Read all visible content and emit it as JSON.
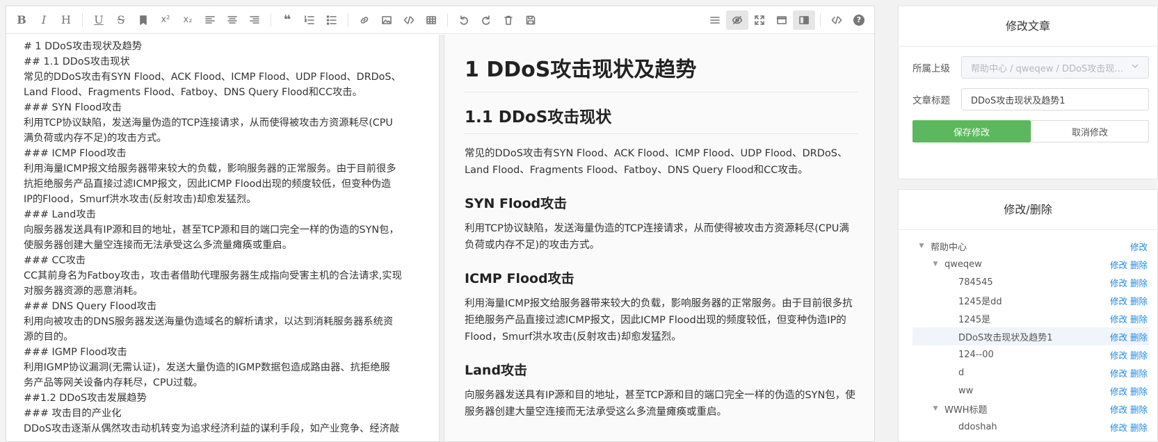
{
  "toolbar": {
    "left": [
      "bold-icon",
      "italic-icon",
      "heading-icon",
      "underline-icon",
      "strikethrough-icon",
      "bookmark-icon",
      "superscript-icon",
      "subscript-icon",
      "align-left-icon",
      "align-center-icon",
      "align-right-icon",
      "quote-icon",
      "ordered-list-icon",
      "unordered-list-icon",
      "link-icon",
      "image-icon",
      "code-icon",
      "table-icon",
      "undo-icon",
      "redo-icon",
      "trash-icon",
      "save-icon"
    ],
    "right": [
      "navigation-icon",
      "preview-toggle-icon",
      "fullscreen-icon",
      "window-icon",
      "split-view-icon",
      "html-code-icon",
      "help-icon"
    ],
    "glyphs": {
      "bold": "B",
      "italic": "I",
      "heading": "H",
      "underline": "U",
      "strike": "S",
      "sup": "x²",
      "sub": "x₂",
      "quote": "❝",
      "help": "?"
    }
  },
  "source": {
    "lines": [
      "# 1 DDoS攻击现状及趋势",
      "## 1.1 DDoS攻击现状",
      "常见的DDoS攻击有SYN Flood、ACK Flood、ICMP Flood、UDP Flood、DRDoS、",
      "Land Flood、Fragments Flood、Fatboy、DNS Query Flood和CC攻击。",
      "### SYN Flood攻击",
      "利用TCP协议缺陷，发送海量伪造的TCP连接请求，从而使得被攻击方资源耗尽(CPU",
      "满负荷或内存不足)的攻击方式。",
      "### ICMP Flood攻击",
      "利用海量ICMP报文给服务器带来较大的负载，影响服务器的正常服务。由于目前很多",
      "抗拒绝服务产品直接过滤ICMP报文，因此ICMP Flood出现的频度较低，但变种伪造",
      "IP的Flood，Smurf洪水攻击(反射攻击)却愈发猛烈。",
      "### Land攻击",
      "向服务器发送具有IP源和目的地址，甚至TCP源和目的端口完全一样的伪造的SYN包，",
      "使服务器创建大量空连接而无法承受这么多流量瘫痪或重启。",
      "### CC攻击",
      "CC其前身名为Fatboy攻击，攻击者借助代理服务器生成指向受害主机的合法请求,实现",
      "对服务器资源的恶意消耗。",
      "### DNS Query Flood攻击",
      "利用向被攻击的DNS服务器发送海量伪造域名的解析请求，以达到消耗服务器系统资",
      "源的目的。",
      "### IGMP Flood攻击",
      "利用IGMP协议漏洞(无需认证)，发送大量伪造的IGMP数据包造成路由器、抗拒绝服",
      "务产品等网关设备内存耗尽，CPU过载。",
      "##1.2 DDoS攻击发展趋势",
      "### 攻击目的产业化",
      "DDoS攻击逐渐从偶然攻击动机转变为追求经济利益的谋利手段，如产业竞争、经济敲"
    ]
  },
  "preview": {
    "h1": "1 DDoS攻击现状及趋势",
    "h2": "1.1 DDoS攻击现状",
    "p1": "常见的DDoS攻击有SYN Flood、ACK Flood、ICMP Flood、UDP Flood、DRDoS、Land Flood、Fragments Flood、Fatboy、DNS Query Flood和CC攻击。",
    "h3a": "SYN Flood攻击",
    "p2": "利用TCP协议缺陷，发送海量伪造的TCP连接请求，从而使得被攻击方资源耗尽(CPU满负荷或内存不足)的攻击方式。",
    "h3b": "ICMP Flood攻击",
    "p3": "利用海量ICMP报文给服务器带来较大的负载，影响服务器的正常服务。由于目前很多抗拒绝服务产品直接过滤ICMP报文，因此ICMP Flood出现的频度较低，但变种伪造IP的Flood，Smurf洪水攻击(反射攻击)却愈发猛烈。",
    "h3c": "Land攻击",
    "p4": "向服务器发送具有IP源和目的地址，甚至TCP源和目的端口完全一样的伪造的SYN包，使服务器创建大量空连接而无法承受这么多流量瘫痪或重启。"
  },
  "edit_panel": {
    "title": "修改文章",
    "parent_label": "所属上级",
    "parent_value": "帮助中心 / qweqew / DDoS攻击现状...",
    "title_label": "文章标题",
    "title_value": "DDoS攻击现状及趋势1",
    "save": "保存修改",
    "cancel": "取消修改"
  },
  "tree_panel": {
    "title": "修改/删除",
    "edit": "修改",
    "del": "删除",
    "nodes": [
      {
        "name": "帮助中心",
        "level": 0,
        "caret": "▼",
        "del": false
      },
      {
        "name": "qweqew",
        "level": 1,
        "caret": "▼",
        "del": true
      },
      {
        "name": "784545",
        "level": 2,
        "caret": "",
        "del": true
      },
      {
        "name": "1245是dd",
        "level": 2,
        "caret": "",
        "del": true
      },
      {
        "name": "1245是",
        "level": 2,
        "caret": "",
        "del": true
      },
      {
        "name": "DDoS攻击现状及趋势1",
        "level": 2,
        "caret": "",
        "del": true,
        "selected": true
      },
      {
        "name": "124--00",
        "level": 2,
        "caret": "",
        "del": true
      },
      {
        "name": "d",
        "level": 2,
        "caret": "",
        "del": true
      },
      {
        "name": "ww",
        "level": 2,
        "caret": "",
        "del": true
      },
      {
        "name": "WWH标题",
        "level": 1,
        "caret": "▼",
        "del": true
      },
      {
        "name": "ddoshah",
        "level": 2,
        "caret": "",
        "del": true
      }
    ]
  },
  "colors": {
    "accent": "#5cb85c",
    "link": "#1e88e5"
  }
}
